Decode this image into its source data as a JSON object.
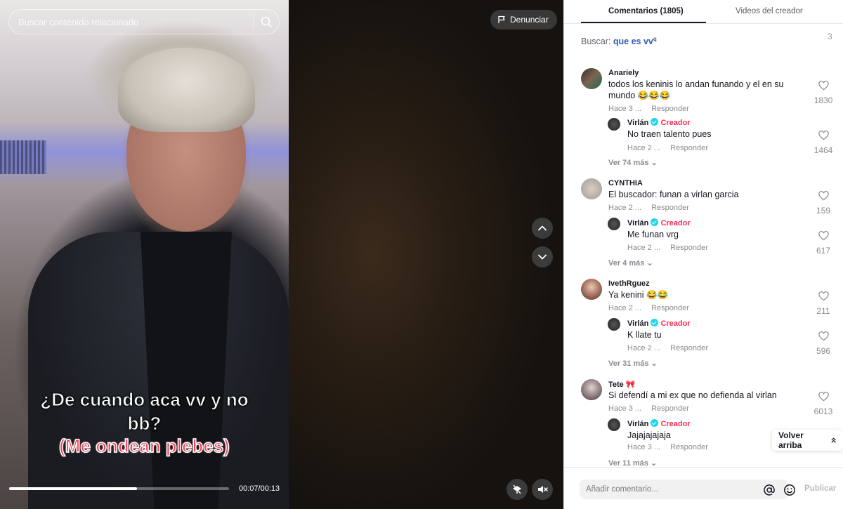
{
  "search": {
    "placeholder": "Buscar contenido relacionado"
  },
  "report_label": "Denunciar",
  "caption": {
    "line1": "¿De cuando aca vv y no",
    "line2": "bb?",
    "line3": "(Me ondean plebes)"
  },
  "player": {
    "time": "00:07/00:13",
    "progress_fraction": 0.58
  },
  "tabs": {
    "comments": "Comentarios (1805)",
    "creator_videos": "Videos del creador"
  },
  "search_row": {
    "label": "Buscar:",
    "keyword": "que es vv",
    "keyword_icon": "q",
    "cut_text": "3"
  },
  "common": {
    "reply": "Responder",
    "creator_badge": "Creador"
  },
  "comments": [
    {
      "user": "Anariely",
      "text": "todos los keninis lo andan funando y el en su mundo 😂😂😂",
      "time": "Hace 3 ...",
      "likes": "1830",
      "reply": {
        "user": "Virlán",
        "text": "No traen talento pues",
        "time": "Hace 2 ...",
        "likes": "1464"
      },
      "more": "Ver 74 más"
    },
    {
      "user": "CYNTHIA",
      "text": "El buscador: funan a virlan garcia",
      "time": "Hace 2 ...",
      "likes": "159",
      "reply": {
        "user": "Virlán",
        "text": "Me funan vrg",
        "time": "Hace 2 ...",
        "likes": "617"
      },
      "more": "Ver 4 más"
    },
    {
      "user": "IvethRguez",
      "text": "Ya kenini 😂😂",
      "time": "Hace 2 ...",
      "likes": "211",
      "reply": {
        "user": "Virlán",
        "text": "K llate tu",
        "time": "Hace 2 ...",
        "likes": "596"
      },
      "more": "Ver 31 más"
    },
    {
      "user": "Tete 🎀",
      "text": "Si defendí a mi ex que no defienda al virlan",
      "time": "Hace 3 ...",
      "likes": "6013",
      "reply": {
        "user": "Virlán",
        "text": "Jajajajajaja",
        "time": "Hace 3 ...",
        "likes": ""
      },
      "more": "Ver 11 más"
    }
  ],
  "back_to_top": "Volver arriba",
  "composer": {
    "placeholder": "Añadir comentario...",
    "post": "Publicar"
  },
  "colors": {
    "accent": "#fe2c55",
    "verified": "#20d5ec",
    "link": "#2b5db9"
  }
}
